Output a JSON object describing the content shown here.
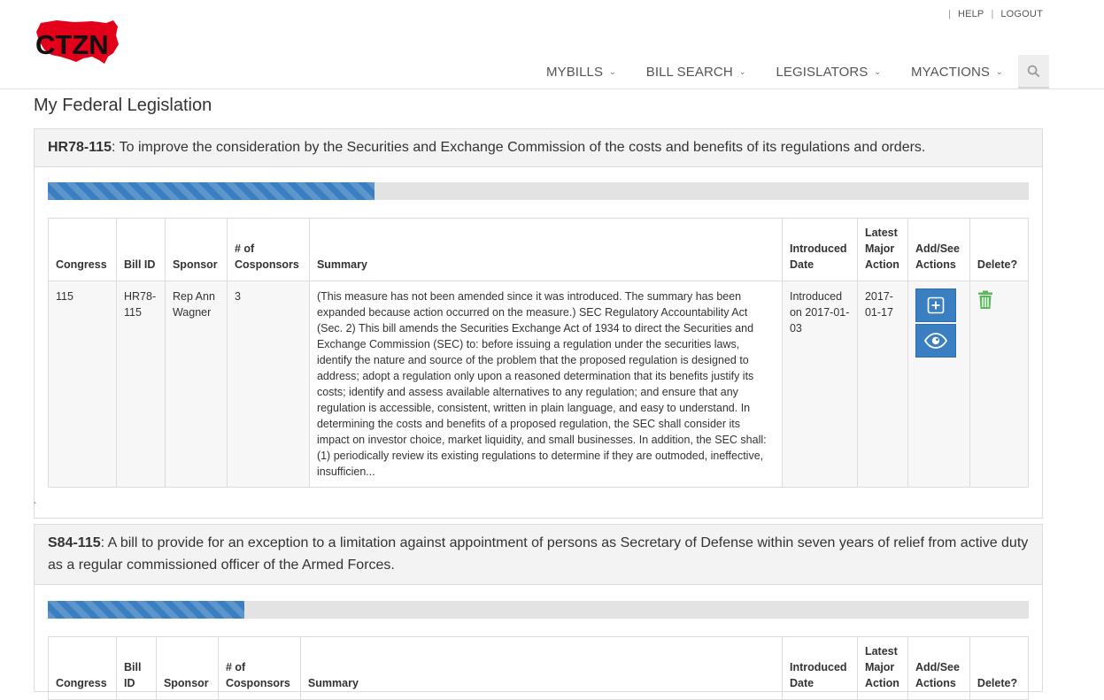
{
  "app": {
    "logo_text": "CTZN"
  },
  "top_links": {
    "help": "HELP",
    "logout": "LOGOUT"
  },
  "nav": {
    "items": [
      {
        "label": "MYBILLS"
      },
      {
        "label": "BILL SEARCH"
      },
      {
        "label": "LEGISLATORS"
      },
      {
        "label": "MYACTIONS"
      }
    ],
    "search_icon": "search-icon"
  },
  "page": {
    "title": "My Federal Legislation"
  },
  "columns": {
    "congress": "Congress",
    "bill_id": "Bill ID",
    "sponsor": "Sponsor",
    "cosponsors": "# of Cosponsors",
    "summary": "Summary",
    "introduced_date": "Introduced Date",
    "latest_action": "Latest Major Action",
    "actions": "Add/See Actions",
    "delete": "Delete?"
  },
  "bills": [
    {
      "code": "HR78-115",
      "title": ": To improve the consideration by the Securities and Exchange Commission of the costs and benefits of its regulations and orders.",
      "progress_percent": 33,
      "row": {
        "congress": "115",
        "bill_id": "HR78-115",
        "sponsor": "Rep Ann Wagner",
        "cosponsors": "3",
        "summary": "(This measure has not been amended since it was introduced. The summary has been expanded because action occurred on the measure.) SEC Regulatory Accountability Act (Sec. 2) This bill amends the Securities Exchange Act of 1934 to direct the Securities and Exchange Commission (SEC) to: before issuing a regulation under the securities laws, identify the nature and source of the problem that the proposed regulation is designed to address; adopt a regulation only upon a reasoned determination that its benefits justify its costs; identify and assess available alternatives to any regulation; and ensure that any regulation is accessible, consistent, written in plain language, and easy to understand. In determining the costs and benefits of a proposed regulation, the SEC shall consider its impact on investor choice, market liquidity, and small businesses. In addition, the SEC shall: (1) periodically review its existing regulations to determine if they are outmoded, ineffective, insufficien...",
        "introduced": "Introduced on 2017-01-03",
        "latest_action": "2017-01-17"
      }
    },
    {
      "code": "S84-115",
      "title": ": A bill to provide for an exception to a limitation against appointment of persons as Secretary of Defense within seven years of relief from active duty as a regular commissioned officer of the Armed Forces.",
      "progress_percent": 20
    }
  ],
  "stray_mark": "`",
  "colors": {
    "accent": "#3a7fc1",
    "logo_red": "#e3001b",
    "delete_green": "#5cb85c"
  }
}
